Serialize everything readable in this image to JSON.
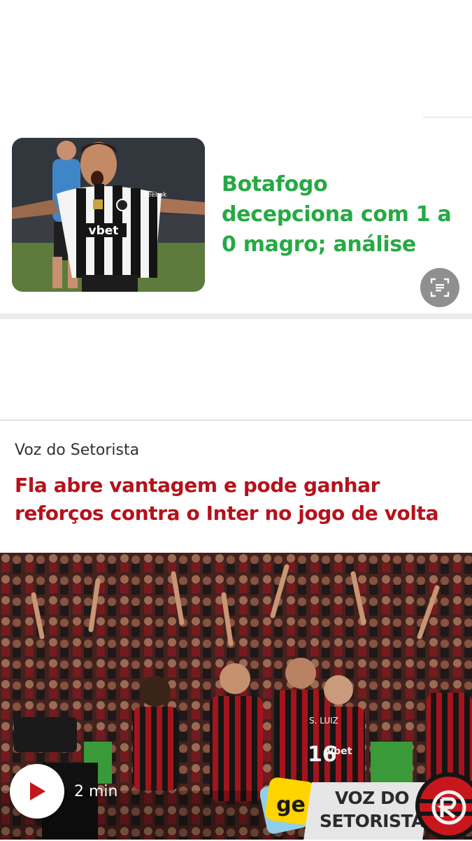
{
  "card_top": {
    "title": "Botafogo decepciona com 1 a 0 magro; análise",
    "image_alt": "Botafogo player celebrating",
    "thumb_texts": {
      "sponsor": "vbet",
      "sleeve": "Reebok"
    }
  },
  "card_main": {
    "section_label": "Voz do Setorista",
    "title": "Fla abre vantagem e pode ganhar reforços contra o Inter no jogo de volta",
    "video": {
      "duration": "2 min",
      "brand_logo": "ge",
      "banner_line1": "VOZ DO",
      "banner_line2": "SETORISTA",
      "jersey_texts": {
        "sponsor": "vbet",
        "number": "16",
        "name": "S. LUIZ"
      }
    }
  },
  "colors": {
    "green_headline": "#26a943",
    "red_headline": "#b5121b",
    "section_label": "#333333",
    "divider": "#ebebeb",
    "play_icon": "#c4161c",
    "ge_brand": "#ffd400"
  },
  "icons": {
    "scan": "scan-text-icon",
    "play": "play-icon"
  }
}
